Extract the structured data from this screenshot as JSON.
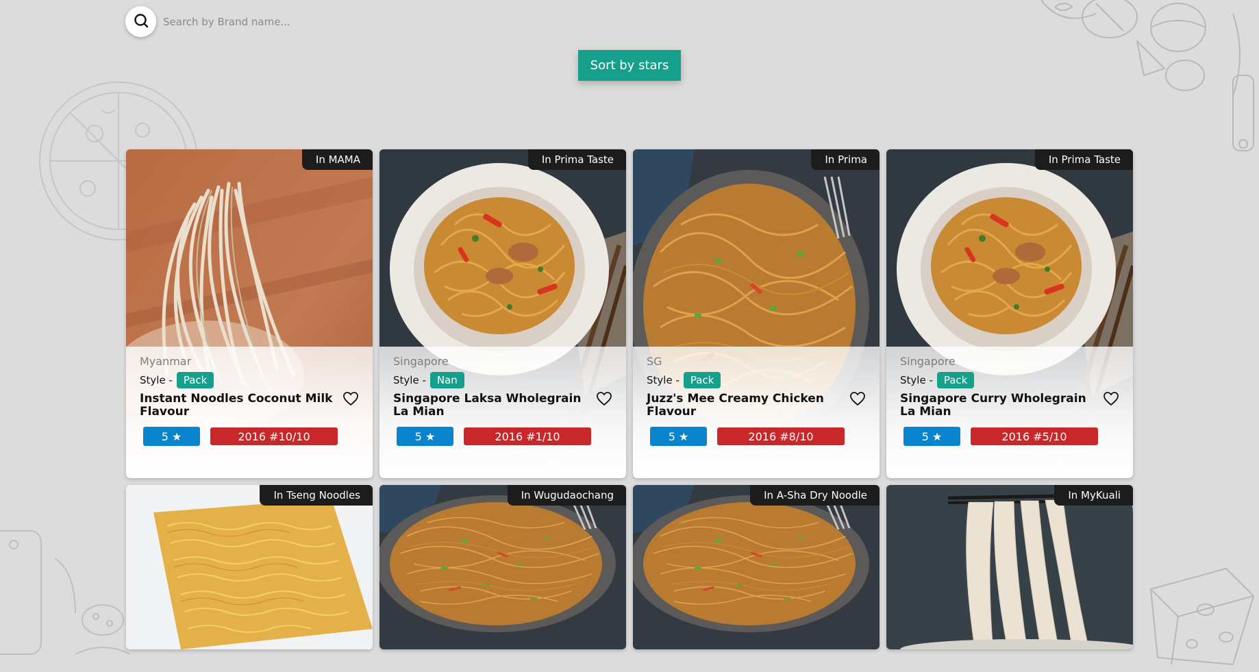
{
  "search": {
    "placeholder": "Search by Brand name...",
    "icon": "search-icon"
  },
  "sort": {
    "label": "Sort by stars",
    "color": "#16a08c"
  },
  "colors": {
    "stars_badge": "#0a84cc",
    "rank_badge": "#c8282a",
    "style_pill": "#16a08c",
    "brand_tag": "#1c1c1c"
  },
  "cards": [
    {
      "brand": "In MAMA",
      "country": "Myanmar",
      "style_label": "Style -",
      "style": "Pack",
      "title": "Instant Noodles Coconut Milk Flavour",
      "stars": "5 ★",
      "rank": "2016 #10/10",
      "image": "raw-noodle-bundle"
    },
    {
      "brand": "In Prima Taste",
      "country": "Singapore",
      "style_label": "Style -",
      "style": "Nan",
      "title": "Singapore Laksa Wholegrain La Mian",
      "stars": "5 ★",
      "rank": "2016 #1/10",
      "image": "noodle-bowl-chicken"
    },
    {
      "brand": "In Prima",
      "country": "SG",
      "style_label": "Style -",
      "style": "Pack",
      "title": "Juzz's Mee Creamy Chicken Flavour",
      "stars": "5 ★",
      "rank": "2016 #8/10",
      "image": "stir-fried-noodles"
    },
    {
      "brand": "In Prima Taste",
      "country": "Singapore",
      "style_label": "Style -",
      "style": "Pack",
      "title": "Singapore Curry Wholegrain La Mian",
      "stars": "5 ★",
      "rank": "2016 #5/10",
      "image": "noodle-bowl-chicken"
    },
    {
      "brand": "In Tseng Noodles",
      "image": "instant-noodle-block"
    },
    {
      "brand": "In Wugudaochang",
      "image": "stir-fried-noodles"
    },
    {
      "brand": "In A-Sha Dry Noodle",
      "image": "stir-fried-noodles"
    },
    {
      "brand": "In MyKuali",
      "image": "flat-noodles-chopsticks"
    }
  ]
}
